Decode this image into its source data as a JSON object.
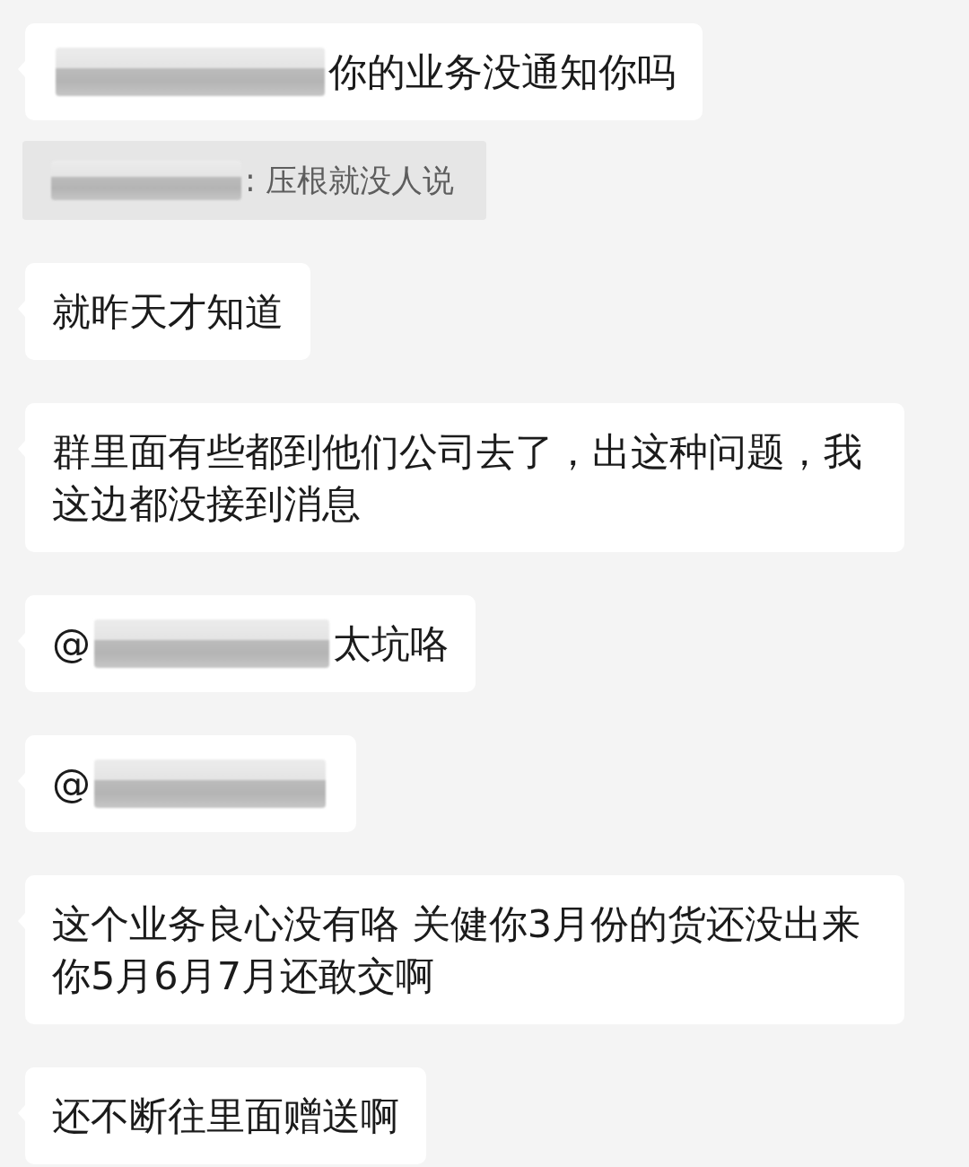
{
  "messages": [
    {
      "kind": "bubble",
      "segments": [
        {
          "kind": "redacted"
        },
        {
          "kind": "text",
          "text": "你的业务没通知你吗"
        }
      ]
    },
    {
      "kind": "quote",
      "segments": [
        {
          "kind": "redacted"
        },
        {
          "kind": "text",
          "text": ": 压根就没人说"
        }
      ]
    },
    {
      "kind": "bubble",
      "segments": [
        {
          "kind": "text",
          "text": "就昨天才知道"
        }
      ]
    },
    {
      "kind": "bubble",
      "segments": [
        {
          "kind": "text",
          "text": "群里面有些都到他们公司去了，出这种问题，我这边都没接到消息"
        }
      ]
    },
    {
      "kind": "bubble",
      "segments": [
        {
          "kind": "mention",
          "text": "@"
        },
        {
          "kind": "redacted"
        },
        {
          "kind": "text",
          "text": "太坑咯"
        }
      ]
    },
    {
      "kind": "bubble",
      "segments": [
        {
          "kind": "mention",
          "text": "@"
        },
        {
          "kind": "redacted"
        }
      ]
    },
    {
      "kind": "bubble",
      "segments": [
        {
          "kind": "text",
          "text": "这个业务良心没有咯 关健你3月份的货还没出来你5月6月7月还敢交啊"
        }
      ]
    },
    {
      "kind": "bubble",
      "segments": [
        {
          "kind": "text",
          "text": "还不断往里面赠送啊"
        }
      ]
    }
  ]
}
